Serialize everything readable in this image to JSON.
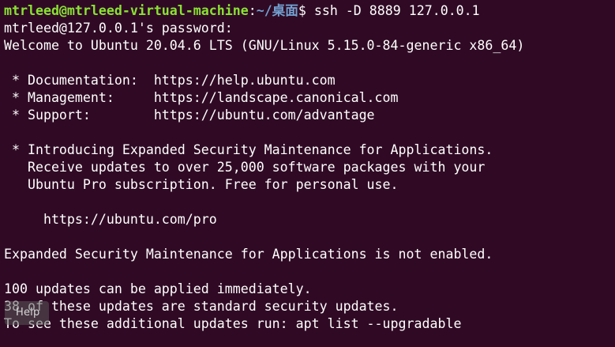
{
  "terminal": {
    "background_color": "#300a24",
    "text_color": "#ffffff",
    "prompt": {
      "user_host": "mtrleed@mtrleed-virtual-machine",
      "colon": ":",
      "path": "~/桌面",
      "symbol": "$ ",
      "command": "ssh -D 8889 127.0.0.1",
      "user_color": "#8ae234",
      "path_color": "#729fcf"
    },
    "lines": [
      "mtrleed@127.0.0.1's password:",
      "Welcome to Ubuntu 20.04.6 LTS (GNU/Linux 5.15.0-84-generic x86_64)",
      "",
      " * Documentation:  https://help.ubuntu.com",
      " * Management:     https://landscape.canonical.com",
      " * Support:        https://ubuntu.com/advantage",
      "",
      " * Introducing Expanded Security Maintenance for Applications.",
      "   Receive updates to over 25,000 software packages with your",
      "   Ubuntu Pro subscription. Free for personal use.",
      "",
      "     https://ubuntu.com/pro",
      "",
      "Expanded Security Maintenance for Applications is not enabled.",
      "",
      "100 updates can be applied immediately.",
      "38 of these updates are standard security updates.",
      "To see these additional updates run: apt list --upgradable"
    ]
  },
  "tooltip": {
    "label": "Help"
  }
}
